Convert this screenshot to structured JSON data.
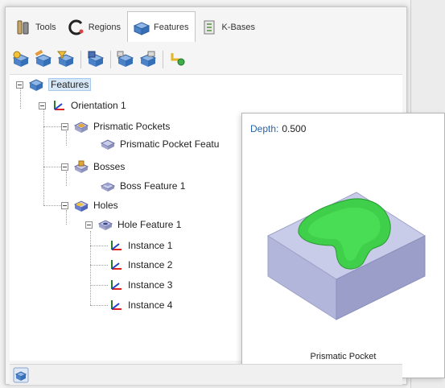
{
  "tabs": [
    {
      "label": "Tools",
      "icon": "tools-icon"
    },
    {
      "label": "Regions",
      "icon": "regions-icon"
    },
    {
      "label": "Features",
      "icon": "features-icon",
      "active": true
    },
    {
      "label": "K-Bases",
      "icon": "kbases-icon"
    }
  ],
  "toolbar": {
    "buttons": [
      "add-feature-icon",
      "edit-feature-icon",
      "filter-feature-icon",
      "save-feature-icon",
      "copy-feature-icon",
      "paste-feature-icon",
      "link-feature-icon"
    ]
  },
  "tree": {
    "root": "Features",
    "orientation": "Orientation 1",
    "prismatic_pockets": "Prismatic Pockets",
    "prismatic_pocket_feature": "Prismatic Pocket Featu",
    "bosses": "Bosses",
    "boss_feature": "Boss Feature 1",
    "holes": "Holes",
    "hole_feature": "Hole Feature 1",
    "instances": [
      "Instance 1",
      "Instance 2",
      "Instance 3",
      "Instance 4"
    ]
  },
  "preview": {
    "depth_label": "Depth:",
    "depth_value": "0.500",
    "caption": "Prismatic Pocket"
  },
  "colors": {
    "pocket_green": "#3fcf4a",
    "block_top": "#c9cce8",
    "block_side": "#a2a6cc",
    "depth_label": "#2a63a8",
    "selection": "#d6e7f7"
  }
}
